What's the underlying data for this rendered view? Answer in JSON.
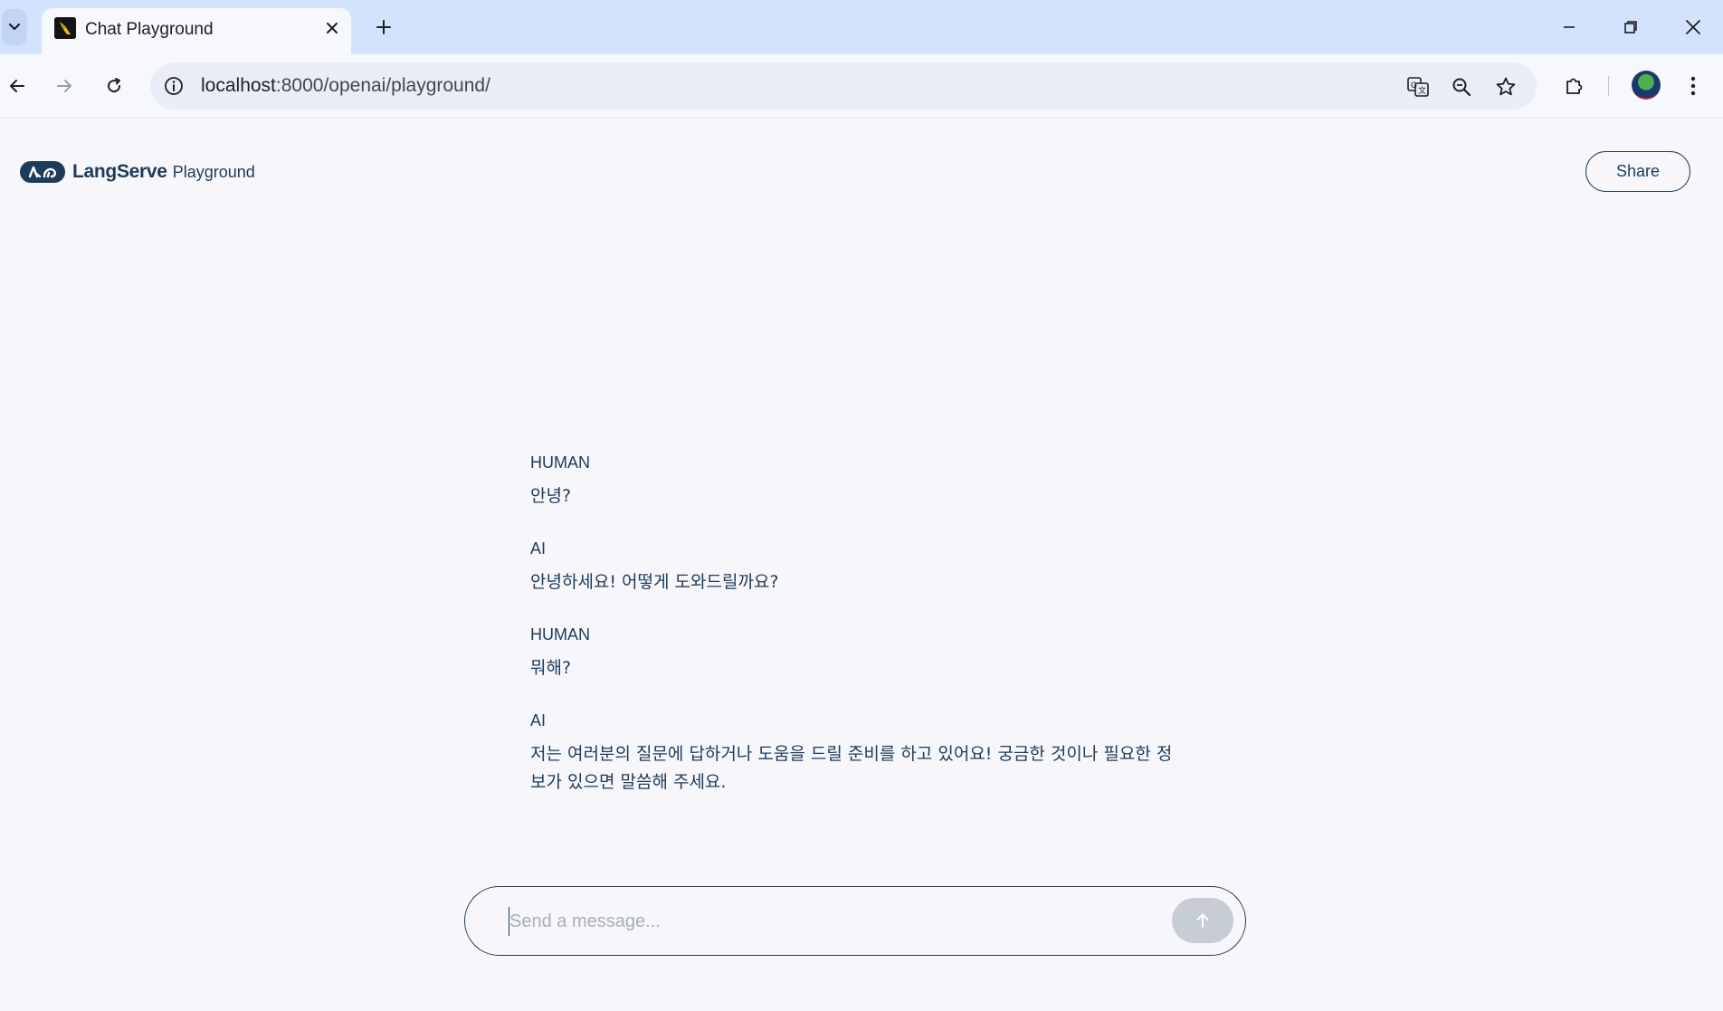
{
  "browser": {
    "tab": {
      "title": "Chat Playground",
      "favicon": "parrot-icon"
    },
    "address": {
      "host": "localhost",
      "path": ":8000/openai/playground/"
    },
    "icons": {
      "tab_list": "chevron-down-icon",
      "tab_close": "close-icon",
      "new_tab": "plus-icon",
      "minimize": "minimize-icon",
      "restore": "restore-icon",
      "window_close": "close-icon",
      "back": "arrow-left-icon",
      "forward": "arrow-right-icon",
      "reload": "reload-icon",
      "site_info": "info-icon",
      "translate": "translate-icon",
      "zoom": "zoom-out-icon",
      "bookmark": "star-icon",
      "extensions": "puzzle-icon",
      "menu": "kebab-menu-icon"
    }
  },
  "header": {
    "brand_name": "LangServe",
    "brand_sub": "Playground",
    "share_label": "Share"
  },
  "chat": {
    "messages": [
      {
        "role": "HUMAN",
        "text": "안녕?"
      },
      {
        "role": "AI",
        "text": "안녕하세요! 어떻게 도와드릴까요?"
      },
      {
        "role": "HUMAN",
        "text": "뭐해?"
      },
      {
        "role": "AI",
        "text": "저는 여러분의 질문에 답하거나 도움을 드릴 준비를 하고 있어요! 궁금한 것이나 필요한 정보가 있으면 말씀해 주세요."
      }
    ]
  },
  "composer": {
    "placeholder": "Send a message...",
    "value": "",
    "send_icon": "arrow-up-icon"
  },
  "colors": {
    "brand": "#1c3c5a",
    "page_bg": "#f7f6fb",
    "tabbar_bg": "#d3e3fd",
    "send_disabled": "#c7cdd5"
  }
}
